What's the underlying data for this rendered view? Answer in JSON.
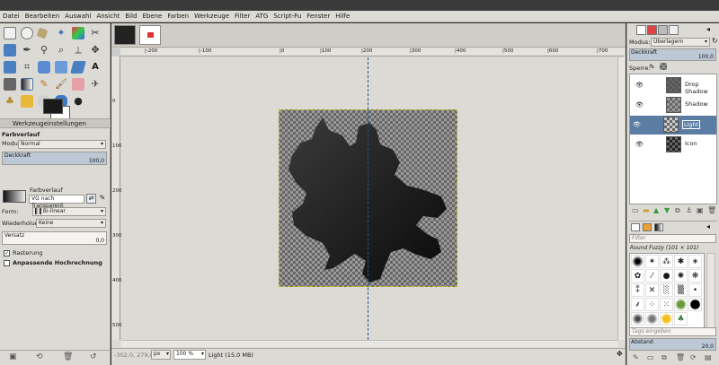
{
  "menu": [
    "Datei",
    "Bearbeiten",
    "Auswahl",
    "Ansicht",
    "Bild",
    "Ebene",
    "Farben",
    "Werkzeuge",
    "Filter",
    "ATG",
    "Script-Fu",
    "Fenster",
    "Hilfe"
  ],
  "tool_options": {
    "header": "Werkzeugeinstellungen",
    "section_title": "Farbverlauf",
    "mode_label": "Modus:",
    "mode_value": "Normal",
    "opacity_label": "Deckkraft",
    "opacity_value": "100,0",
    "gradient_label": "Farbverlauf",
    "gradient_value": "VG nach Transparent",
    "shape_label": "Form:",
    "shape_value": "Bi-linear",
    "repeat_label": "Wiederholung:",
    "repeat_value": "Keine",
    "offset_label": "Versatz",
    "offset_value": "0,0",
    "dither_label": "Rasterung",
    "adaptive_label": "Anpassende Hochrechnung"
  },
  "ruler_ticks": [
    "|-200",
    "|-100",
    "|0",
    "|100",
    "|200",
    "|300",
    "|400",
    "|500",
    "|600",
    "|700"
  ],
  "vruler_ticks": [
    "0",
    "100",
    "200",
    "300",
    "400",
    "500"
  ],
  "status": {
    "coords": "-302,0, 279,0",
    "unit": "px",
    "zoom": "100 %",
    "layer_info": "Light (15,0 MB)"
  },
  "layers_panel": {
    "mode_label": "Modus:",
    "mode_value": "Überlagern",
    "opacity_label": "Deckkraft",
    "opacity_value": "100,0",
    "lock_label": "Sperre:",
    "layers": [
      {
        "name": "Drop Shadow"
      },
      {
        "name": "Shadow"
      },
      {
        "name": "Light"
      },
      {
        "name": "Icon"
      }
    ]
  },
  "brushes_panel": {
    "filter_placeholder": "Filter",
    "brush_title": "Round Fuzzy (101 × 101)",
    "tags_placeholder": "Tags eingeben",
    "spacing_label": "Abstand",
    "spacing_value": "20,0"
  },
  "colors": {
    "selected_row": "#5c7da3",
    "guide": "#2a4f9a",
    "panel_bg": "#dcdad5"
  }
}
